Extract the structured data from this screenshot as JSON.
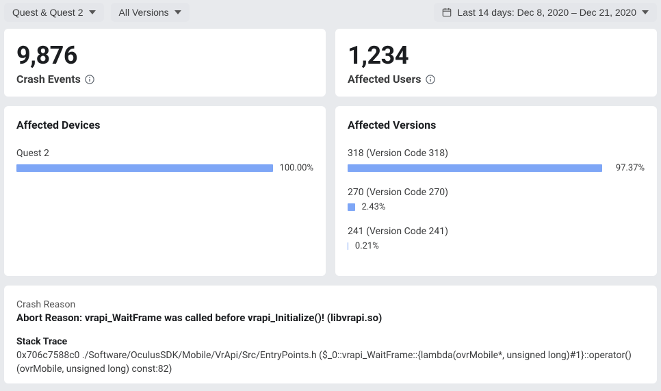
{
  "filters": {
    "device": "Quest & Quest 2",
    "version": "All Versions",
    "date_range": "Last 14 days: Dec 8, 2020 – Dec 21, 2020"
  },
  "stats": {
    "crash_events": {
      "value": "9,876",
      "label": "Crash Events"
    },
    "affected_users": {
      "value": "1,234",
      "label": "Affected Users"
    }
  },
  "affected_devices": {
    "title": "Affected Devices",
    "rows": [
      {
        "label": "Quest 2",
        "pct_text": "100.00%"
      }
    ]
  },
  "affected_versions": {
    "title": "Affected Versions",
    "rows": [
      {
        "label": "318 (Version Code 318)",
        "pct_text": "97.37%"
      },
      {
        "label": "270 (Version Code 270)",
        "pct_text": "2.43%"
      },
      {
        "label": "241 (Version Code 241)",
        "pct_text": "0.21%"
      }
    ]
  },
  "crash_reason": {
    "heading": "Crash Reason",
    "text": "Abort Reason: vrapi_WaitFrame was called before vrapi_Initialize()! (libvrapi.so)"
  },
  "stack_trace": {
    "heading": "Stack Trace",
    "line1": "0x706c7588c0 ./Software/OculusSDK/Mobile/VrApi/Src/EntryPoints.h ($_0::vrapi_WaitFrame::{lambda(ovrMobile*, unsigned long)#1}::operator()(ovrMobile, unsigned long) const:82)"
  },
  "chart_data": [
    {
      "type": "bar",
      "title": "Affected Devices",
      "categories": [
        "Quest 2"
      ],
      "values": [
        100.0
      ],
      "xlabel": "",
      "ylabel": "Percent",
      "ylim": [
        0,
        100
      ]
    },
    {
      "type": "bar",
      "title": "Affected Versions",
      "categories": [
        "318 (Version Code 318)",
        "270 (Version Code 270)",
        "241 (Version Code 241)"
      ],
      "values": [
        97.37,
        2.43,
        0.21
      ],
      "xlabel": "",
      "ylabel": "Percent",
      "ylim": [
        0,
        100
      ]
    }
  ]
}
